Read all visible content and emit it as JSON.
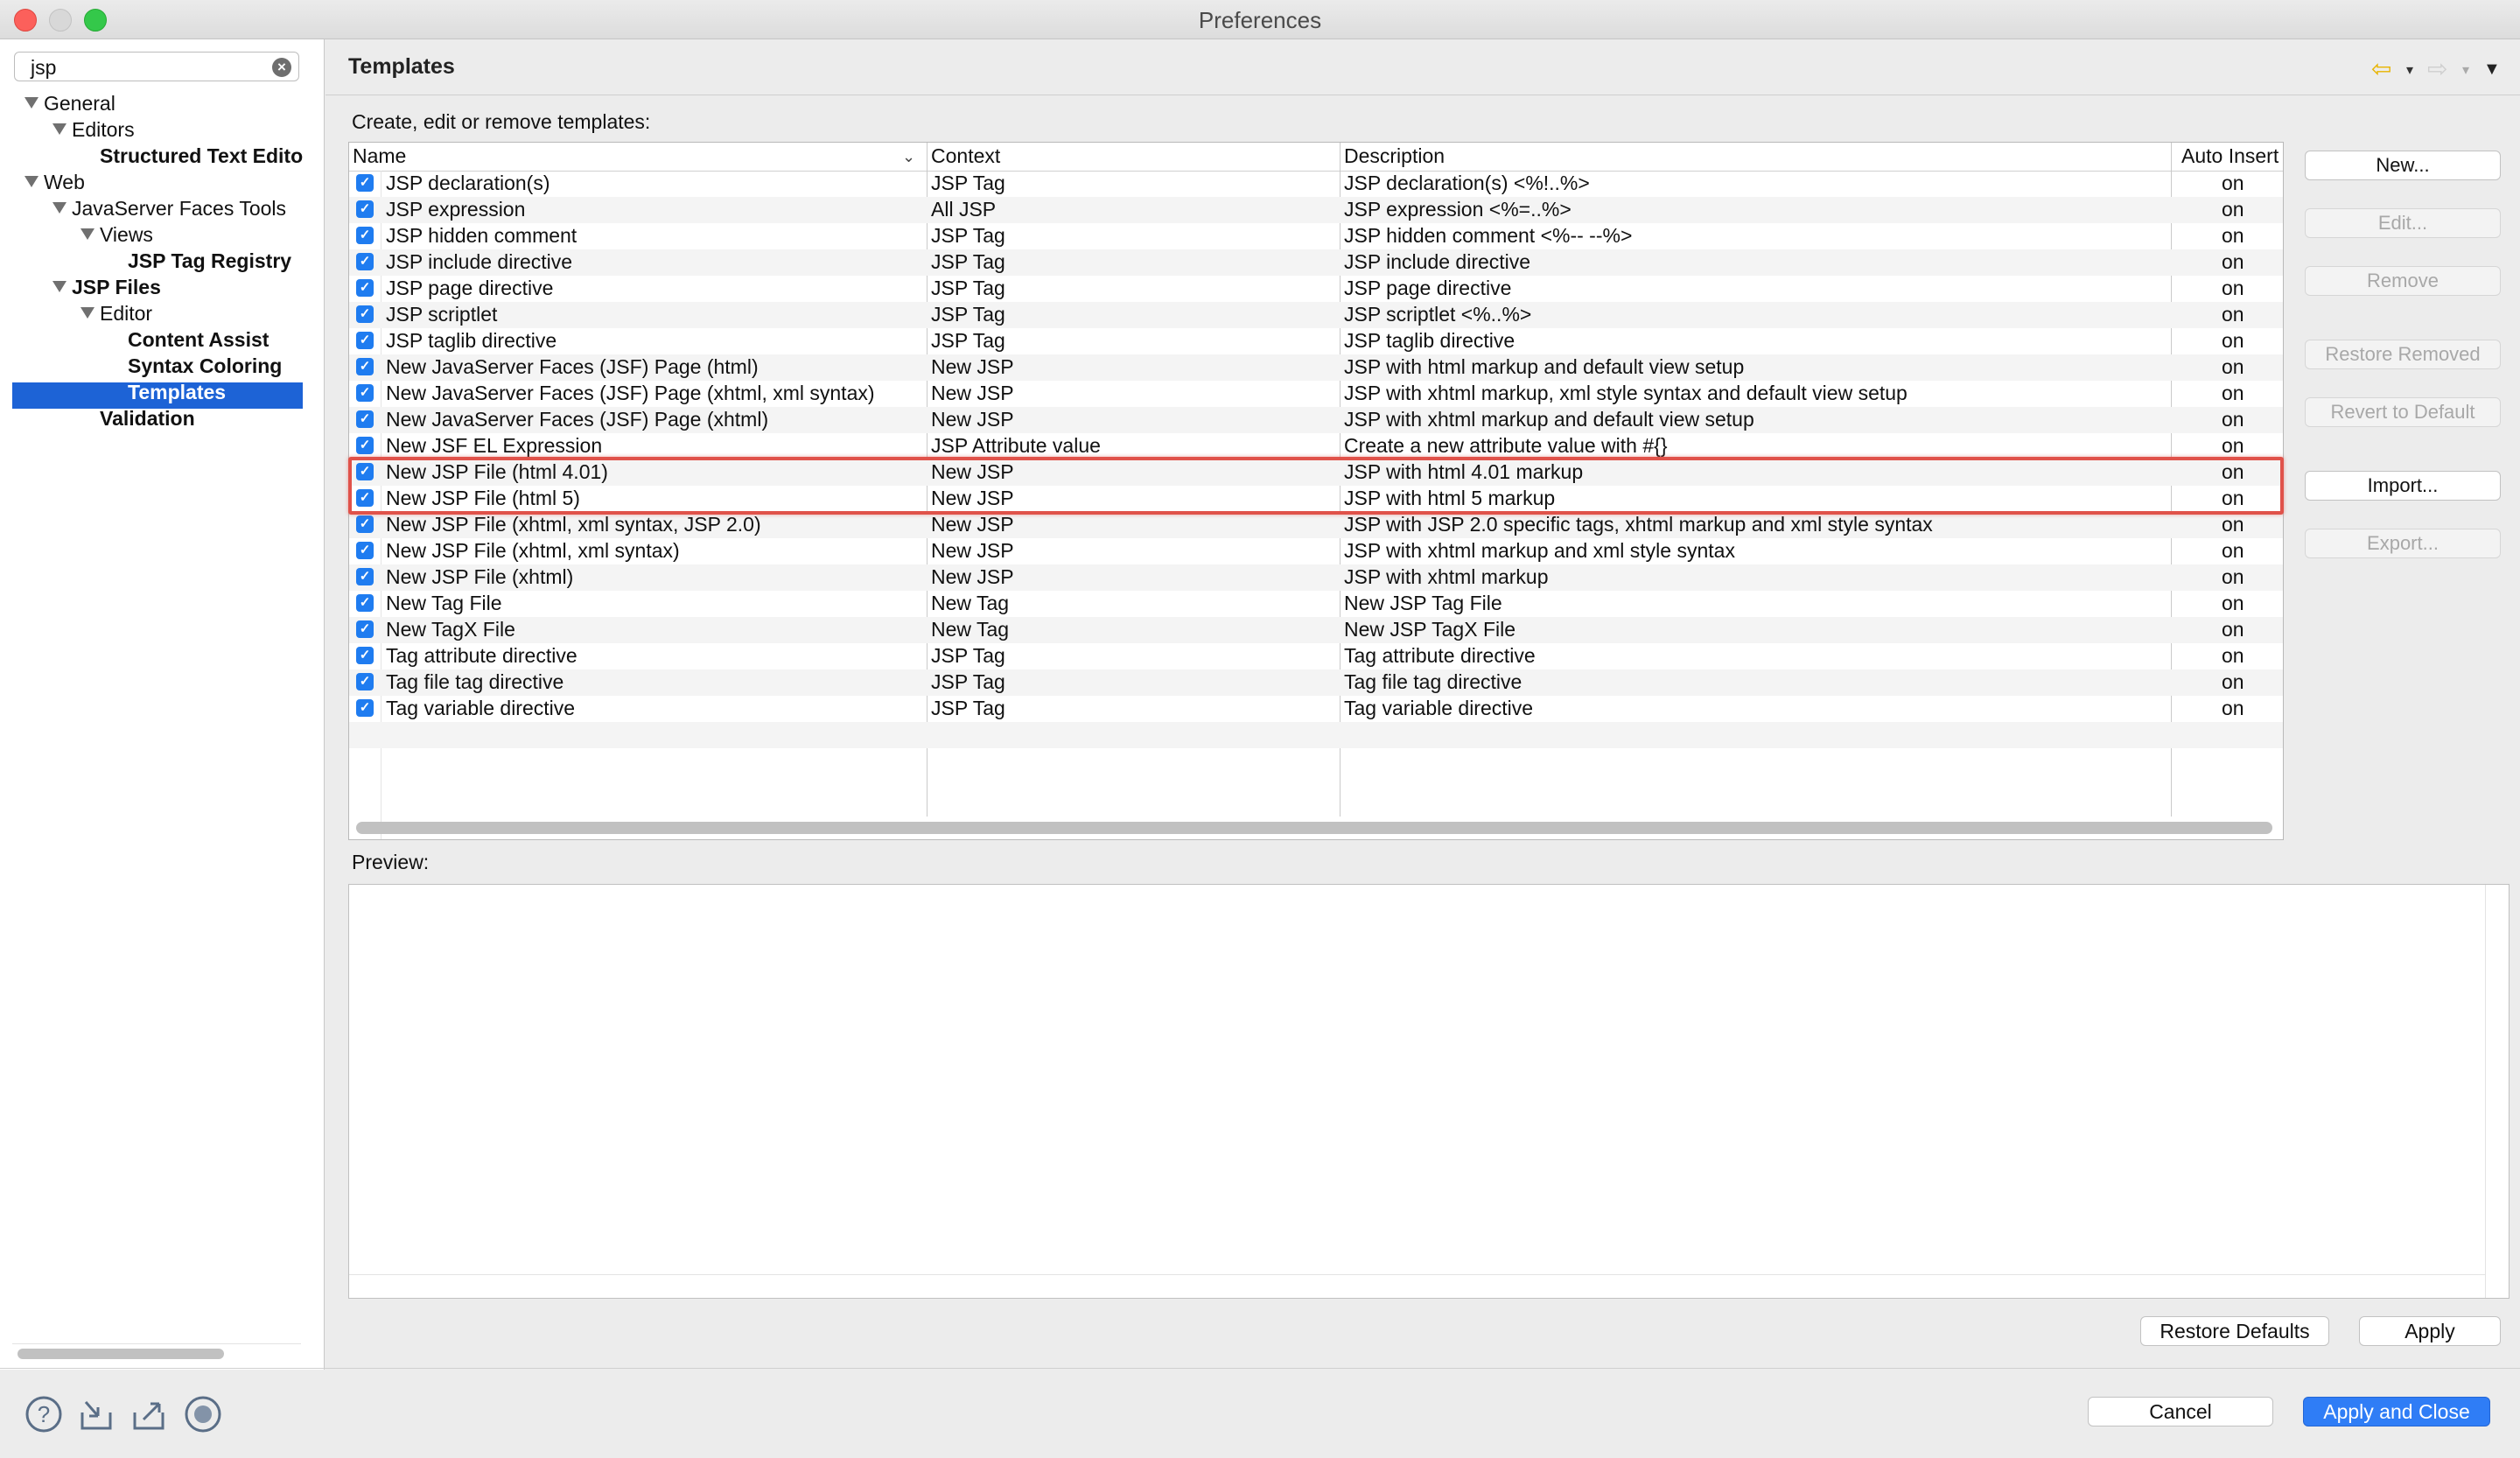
{
  "window": {
    "title": "Preferences"
  },
  "search": {
    "value": "jsp"
  },
  "tree": {
    "general": "General",
    "editors": "Editors",
    "structured_text_editors": "Structured Text Edito",
    "web": "Web",
    "jsf_tools": "JavaServer Faces Tools",
    "views": "Views",
    "jsp_tag_registry": "JSP Tag Registry",
    "jsp_files": "JSP Files",
    "editor": "Editor",
    "content_assist": "Content Assist",
    "syntax_coloring": "Syntax Coloring",
    "templates": "Templates",
    "validation": "Validation",
    "selected": "Templates"
  },
  "page": {
    "title": "Templates",
    "create_label": "Create, edit or remove templates:",
    "preview_label": "Preview:"
  },
  "table": {
    "headers": {
      "name": "Name",
      "context": "Context",
      "description": "Description",
      "auto_insert": "Auto Insert"
    },
    "rows": [
      {
        "name": "JSP declaration(s)",
        "context": "JSP Tag",
        "description": "JSP declaration(s) <%!..%>",
        "auto_insert": "on",
        "checked": true
      },
      {
        "name": "JSP expression",
        "context": "All JSP",
        "description": "JSP expression <%=..%>",
        "auto_insert": "on",
        "checked": true
      },
      {
        "name": "JSP hidden comment",
        "context": "JSP Tag",
        "description": "JSP hidden comment <%-- --%>",
        "auto_insert": "on",
        "checked": true
      },
      {
        "name": "JSP include directive",
        "context": "JSP Tag",
        "description": "JSP include directive",
        "auto_insert": "on",
        "checked": true
      },
      {
        "name": "JSP page directive",
        "context": "JSP Tag",
        "description": "JSP page directive",
        "auto_insert": "on",
        "checked": true
      },
      {
        "name": "JSP scriptlet",
        "context": "JSP Tag",
        "description": "JSP scriptlet <%..%>",
        "auto_insert": "on",
        "checked": true
      },
      {
        "name": "JSP taglib directive",
        "context": "JSP Tag",
        "description": "JSP taglib directive",
        "auto_insert": "on",
        "checked": true
      },
      {
        "name": "New JavaServer Faces (JSF) Page (html)",
        "context": "New JSP",
        "description": "JSP with html markup and default view setup",
        "auto_insert": "on",
        "checked": true
      },
      {
        "name": "New JavaServer Faces (JSF) Page (xhtml, xml syntax)",
        "context": "New JSP",
        "description": "JSP with xhtml markup, xml style syntax and default view setup",
        "auto_insert": "on",
        "checked": true
      },
      {
        "name": "New JavaServer Faces (JSF) Page (xhtml)",
        "context": "New JSP",
        "description": "JSP with xhtml markup and default view setup",
        "auto_insert": "on",
        "checked": true
      },
      {
        "name": "New JSF EL Expression",
        "context": "JSP Attribute value",
        "description": "Create a new attribute value with #{}",
        "auto_insert": "on",
        "checked": true
      },
      {
        "name": "New JSP File (html 4.01)",
        "context": "New JSP",
        "description": "JSP with html 4.01 markup",
        "auto_insert": "on",
        "checked": true
      },
      {
        "name": "New JSP File (html 5)",
        "context": "New JSP",
        "description": "JSP with html 5 markup",
        "auto_insert": "on",
        "checked": true
      },
      {
        "name": "New JSP File (xhtml, xml syntax, JSP 2.0)",
        "context": "New JSP",
        "description": "JSP with JSP 2.0 specific tags, xhtml markup and xml style syntax",
        "auto_insert": "on",
        "checked": true
      },
      {
        "name": "New JSP File (xhtml, xml syntax)",
        "context": "New JSP",
        "description": "JSP with xhtml markup and xml style syntax",
        "auto_insert": "on",
        "checked": true
      },
      {
        "name": "New JSP File (xhtml)",
        "context": "New JSP",
        "description": "JSP with xhtml markup",
        "auto_insert": "on",
        "checked": true
      },
      {
        "name": "New Tag File",
        "context": "New Tag",
        "description": "New JSP Tag File",
        "auto_insert": "on",
        "checked": true
      },
      {
        "name": "New TagX File",
        "context": "New Tag",
        "description": "New JSP TagX File",
        "auto_insert": "on",
        "checked": true
      },
      {
        "name": "Tag attribute directive",
        "context": "JSP Tag",
        "description": "Tag attribute directive",
        "auto_insert": "on",
        "checked": true
      },
      {
        "name": "Tag file tag directive",
        "context": "JSP Tag",
        "description": "Tag file tag directive",
        "auto_insert": "on",
        "checked": true
      },
      {
        "name": "Tag variable directive",
        "context": "JSP Tag",
        "description": "Tag variable directive",
        "auto_insert": "on",
        "checked": true
      }
    ]
  },
  "side_buttons": {
    "new": "New...",
    "edit": "Edit...",
    "remove": "Remove",
    "restore_removed": "Restore Removed",
    "revert_to_default": "Revert to Default",
    "import": "Import...",
    "export": "Export..."
  },
  "footer": {
    "restore_defaults": "Restore Defaults",
    "apply": "Apply",
    "cancel": "Cancel",
    "apply_and_close": "Apply and Close"
  },
  "colors": {
    "selection": "#1d63d6",
    "checkbox": "#1f7cf0",
    "highlight": "#e0524a",
    "primary_button": "#2f7df6"
  },
  "icons": [
    "help-icon",
    "import-prefs-icon",
    "export-prefs-icon",
    "record-icon",
    "back-arrow-icon",
    "forward-arrow-icon",
    "view-menu-icon"
  ]
}
